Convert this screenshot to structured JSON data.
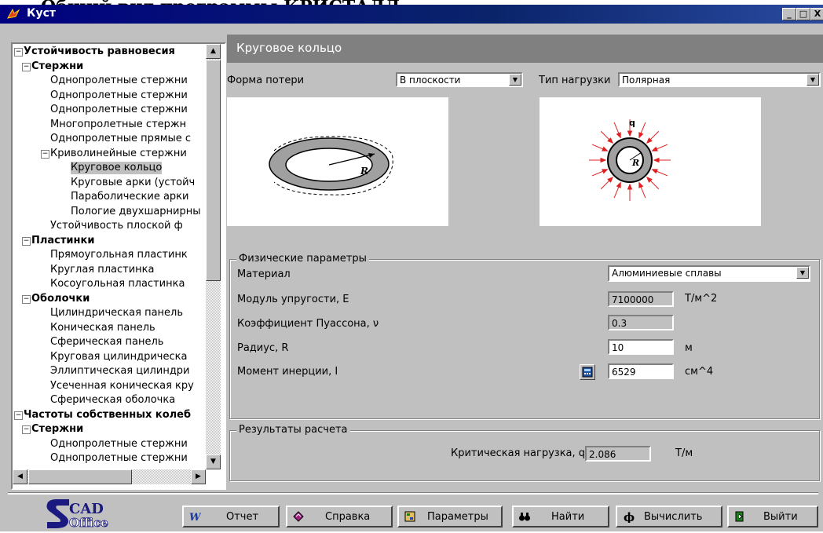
{
  "header": {
    "caption": "Общий вид программы КРИСТАЛЛ"
  },
  "window": {
    "title": "Куст",
    "btn_min": "_",
    "btn_max": "□",
    "btn_close": "X"
  },
  "tree": [
    {
      "label": "Устойчивость равновесия",
      "depth": 0,
      "bold": true,
      "toggle": "⊟"
    },
    {
      "label": "Стержни",
      "depth": 1,
      "bold": true,
      "toggle": "⊟"
    },
    {
      "label": "Однопролетные стержни",
      "depth": 2
    },
    {
      "label": "Однопролетные стержни",
      "depth": 2
    },
    {
      "label": "Однопролетные стержни",
      "depth": 2
    },
    {
      "label": "Многопролетные стержн",
      "depth": 2
    },
    {
      "label": "Однопролетные прямые с",
      "depth": 2
    },
    {
      "label": "Криволинейные стержни",
      "depth": 2,
      "toggle": "⊟"
    },
    {
      "label": "Круговое кольцо",
      "depth": 3,
      "selected": true
    },
    {
      "label": "Круговые арки (устойч",
      "depth": 3
    },
    {
      "label": "Параболические арки",
      "depth": 3
    },
    {
      "label": "Пологие двухшарнирны",
      "depth": 3
    },
    {
      "label": "Устойчивость плоской ф",
      "depth": 2
    },
    {
      "label": "Пластинки",
      "depth": 1,
      "bold": true,
      "toggle": "⊟"
    },
    {
      "label": "Прямоугольная пластинк",
      "depth": 2
    },
    {
      "label": "Круглая пластинка",
      "depth": 2
    },
    {
      "label": "Косоугольная пластинка",
      "depth": 2
    },
    {
      "label": "Оболочки",
      "depth": 1,
      "bold": true,
      "toggle": "⊟"
    },
    {
      "label": "Цилиндрическая панель",
      "depth": 2
    },
    {
      "label": "Коническая панель",
      "depth": 2
    },
    {
      "label": "Сферическая панель",
      "depth": 2
    },
    {
      "label": "Круговая цилиндрическа",
      "depth": 2
    },
    {
      "label": "Эллиптическая цилиндри",
      "depth": 2
    },
    {
      "label": "Усеченная коническая кру",
      "depth": 2
    },
    {
      "label": "Сферическая оболочка",
      "depth": 2
    },
    {
      "label": "Частоты собственных колеб",
      "depth": 0,
      "bold": true,
      "toggle": "⊟"
    },
    {
      "label": "Стержни",
      "depth": 1,
      "bold": true,
      "toggle": "⊟"
    },
    {
      "label": "Однопролетные стержни",
      "depth": 2
    },
    {
      "label": "Однопролетные стержни",
      "depth": 2
    }
  ],
  "panel": {
    "title": "Круговое кольцо",
    "loss_form_label": "Форма потери",
    "loss_form_value": "В плоскости",
    "load_type_label": "Тип нагрузки",
    "load_type_value": "Полярная",
    "img_left_label": "R",
    "img_right_label_q": "q",
    "img_right_label_r": "R"
  },
  "physical": {
    "group_title": "Физические параметры",
    "material_label": "Материал",
    "material_value": "Алюминиевые сплавы",
    "modulus_label": "Модуль упругости, E",
    "modulus_value": "7100000",
    "modulus_unit": "Т/м^2",
    "poisson_label": "Коэффициент Пуассона, ν",
    "poisson_value": "0.3",
    "radius_label": "Радиус, R",
    "radius_value": "10",
    "radius_unit": "м",
    "inertia_label": "Момент инерции, I",
    "inertia_value": "6529",
    "inertia_unit": "см^4"
  },
  "results": {
    "group_title": "Результаты расчета",
    "critical_label": "Критическая нагрузка, qₓ",
    "critical_value": "2.086",
    "critical_unit": "Т/м"
  },
  "toolbar": {
    "logo_top": "CAD",
    "logo_bottom": "Office",
    "report": "Отчет",
    "help": "Справка",
    "params": "Параметры",
    "find": "Найти",
    "compute": "Вычислить",
    "exit": "Выйти"
  }
}
